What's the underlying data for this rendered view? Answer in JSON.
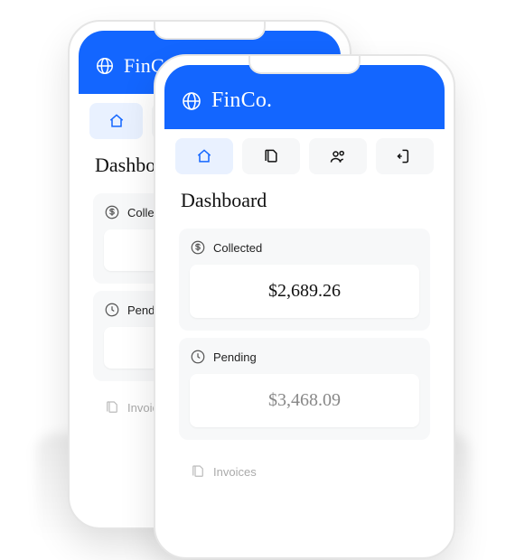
{
  "brand": "FinCo.",
  "nav": {
    "home": "home",
    "documents": "documents",
    "users": "users",
    "logout": "logout"
  },
  "page_title": "Dashboard",
  "cards": {
    "collected": {
      "label": "Collected",
      "value": "$2,689.26"
    },
    "pending": {
      "label": "Pending",
      "value": "$3,468.09"
    },
    "invoices": {
      "label": "Invoices"
    }
  },
  "back_phone": {
    "page_title": "Dashboard",
    "collected_label": "Collected",
    "pending_label": "Pending",
    "invoices_label": "Invoices"
  }
}
